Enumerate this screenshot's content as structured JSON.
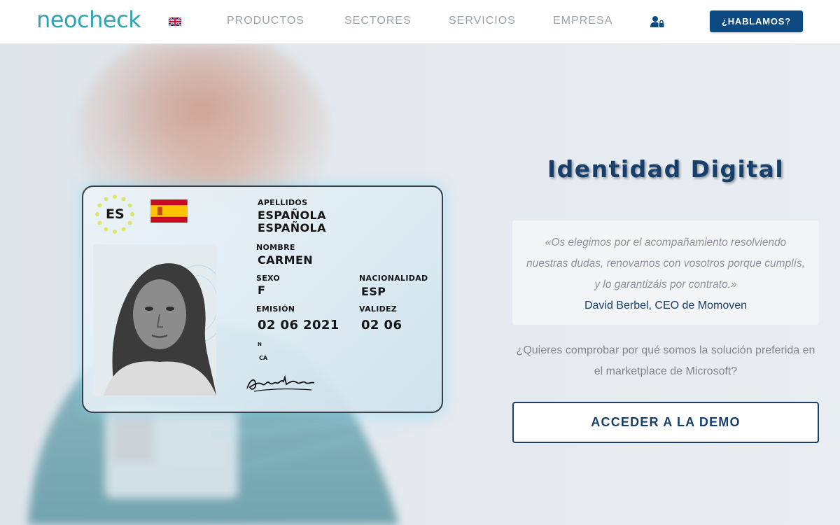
{
  "header": {
    "logo_text": "neocheck",
    "language_flag": "uk-flag",
    "nav": [
      {
        "label": "PRODUCTOS"
      },
      {
        "label": "SECTORES"
      },
      {
        "label": "SERVICIOS"
      },
      {
        "label": "EMPRESA"
      }
    ],
    "login_icon": "user-lock-icon",
    "cta_label": "¿HABLAMOS?"
  },
  "id_card": {
    "country_code": "ES",
    "surname_label": "APELLIDOS",
    "surname_1": "ESPAÑOLA",
    "surname_2": "ESPAÑOLA",
    "name_label": "NOMBRE",
    "name": "CARMEN",
    "sex_label": "SEXO",
    "sex": "F",
    "nationality_label": "NACIONALIDAD",
    "nationality": "ESP",
    "issue_label": "EMISIÓN",
    "issue_date": "02 06 2021",
    "valid_label": "VALIDEZ",
    "valid_date": "02 06",
    "extra_1": "N",
    "extra_2": "CA"
  },
  "hero": {
    "title": "Identidad Digital",
    "quote": "«Os elegimos por el acompañamiento resolviendo nuestras dudas, renovamos con vosotros porque cumplís, y lo garantizáis por contrato.»",
    "quote_author": "David Berbel, CEO de Momoven",
    "question": "¿Quieres comprobar por qué somos la solución preferida en el marketplace de Microsoft?",
    "demo_button": "ACCEDER A LA DEMO"
  },
  "colors": {
    "brand_teal": "#2fa5b4",
    "brand_navy": "#0d4a82",
    "title_navy": "#16406b",
    "nav_gray": "#9aa3ab"
  }
}
